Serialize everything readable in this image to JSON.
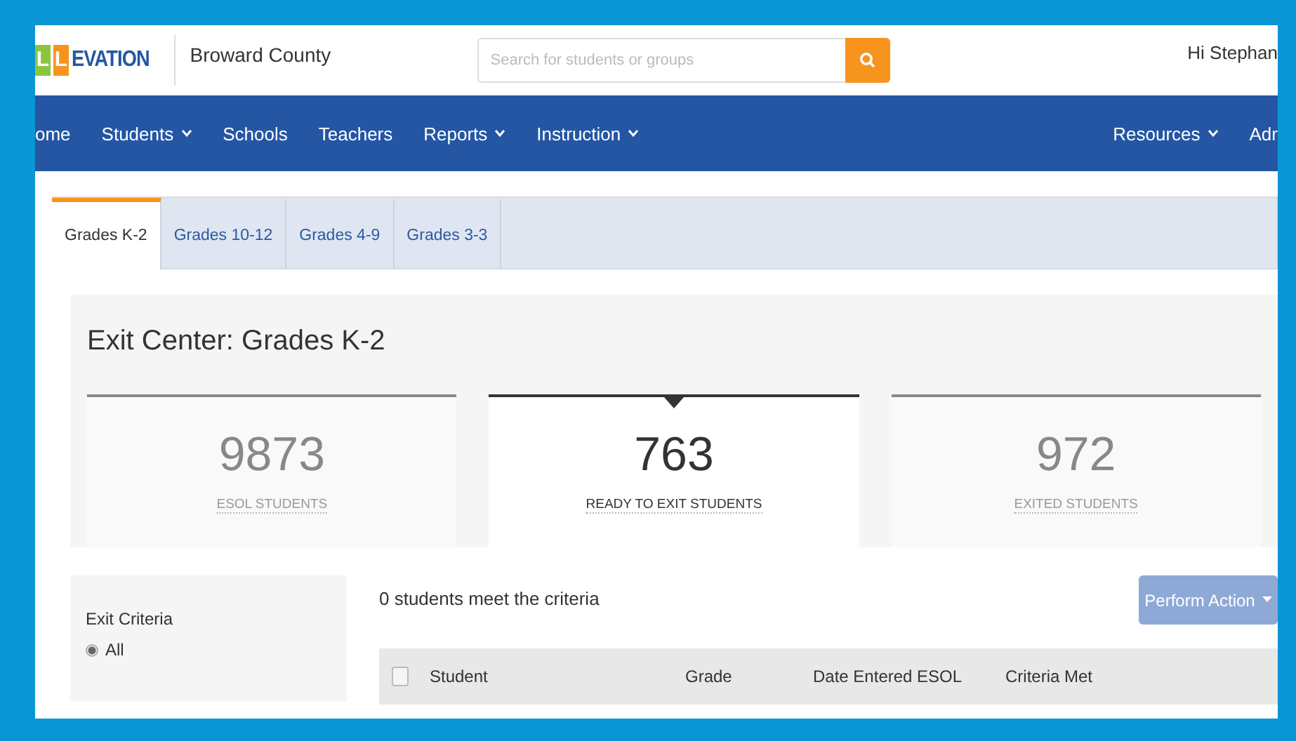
{
  "header": {
    "logo": {
      "boxed": [
        "L",
        "L"
      ],
      "rest": "EVATION"
    },
    "district": "Broward County",
    "search": {
      "placeholder": "Search for students or groups"
    },
    "greeting": "Hi Stephan"
  },
  "nav": {
    "left": [
      {
        "label": "ome",
        "dropdown": false
      },
      {
        "label": "Students",
        "dropdown": true
      },
      {
        "label": "Schools",
        "dropdown": false
      },
      {
        "label": "Teachers",
        "dropdown": false
      },
      {
        "label": "Reports",
        "dropdown": true
      },
      {
        "label": "Instruction",
        "dropdown": true
      }
    ],
    "right": [
      {
        "label": "Resources",
        "dropdown": true
      },
      {
        "label": "Adr",
        "dropdown": false
      }
    ]
  },
  "tabs": [
    {
      "label": "Grades K-2",
      "selected": true
    },
    {
      "label": "Grades 10-12",
      "selected": false
    },
    {
      "label": "Grades 4-9",
      "selected": false
    },
    {
      "label": "Grades 3-3",
      "selected": false
    }
  ],
  "title": "Exit Center: Grades K-2",
  "stats": [
    {
      "value": "9873",
      "label": "ESOL STUDENTS",
      "selected": false
    },
    {
      "value": "763",
      "label": "READY TO EXIT STUDENTS",
      "selected": true
    },
    {
      "value": "972",
      "label": "EXITED STUDENTS",
      "selected": false
    }
  ],
  "filters": {
    "title": "Exit Criteria",
    "options": [
      {
        "label": "All",
        "selected": true
      }
    ]
  },
  "result_text": "0 students meet the criteria",
  "action_button": "Perform Action",
  "table": {
    "columns": [
      "Student",
      "Grade",
      "Date Entered ESOL",
      "Criteria Met"
    ],
    "select_all_checked": false
  }
}
